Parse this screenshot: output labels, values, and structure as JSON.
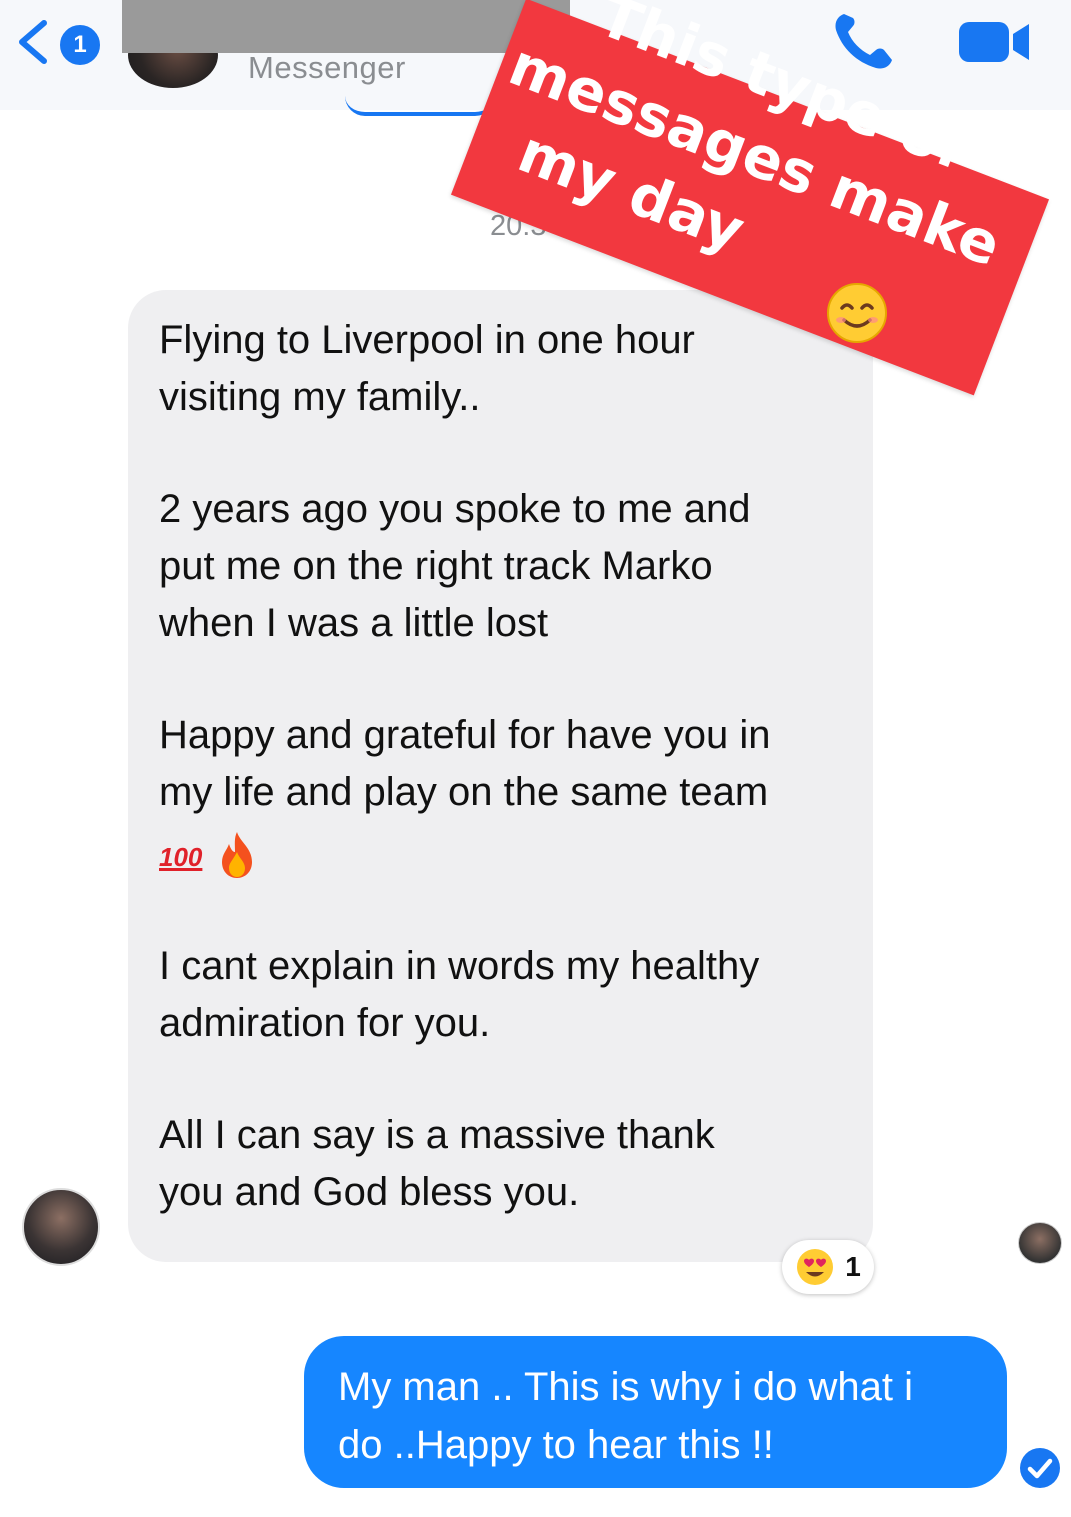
{
  "header": {
    "back_badge_count": "1",
    "subtitle": "Messenger",
    "accent_color": "#1877f2",
    "icons": [
      "chevron-left-icon",
      "phone-icon",
      "video-camera-icon"
    ]
  },
  "conversation": {
    "timestamp": "20:3",
    "incoming_message": {
      "paragraphs": [
        "Flying to Liverpool in one hour\nvisiting my family..",
        "2 years ago you spoke to me and\nput me on the right track Marko\nwhen I was a little lost",
        "Happy and grateful for have you in\nmy life and play on the same team"
      ],
      "emoji_hundred": "100",
      "emoji_names": [
        "hundred-points-icon",
        "fire-icon"
      ],
      "paragraphs_after": [
        "I cant explain in words my healthy\nadmiration for you.",
        "All I can say is a massive thank\nyou and God bless you."
      ],
      "reaction": {
        "icon": "heart-eyes-emoji-icon",
        "count": "1"
      }
    },
    "outgoing_message": {
      "text": "My man .. This is why i do what i\ndo ..Happy to hear this !!",
      "bubble_color": "#1686ff"
    }
  },
  "sticker": {
    "text_line1": "This type of",
    "text_line2": "messages make",
    "text_line3": "my day",
    "color": "#f2383f",
    "emoji": "smiling-face-icon"
  }
}
